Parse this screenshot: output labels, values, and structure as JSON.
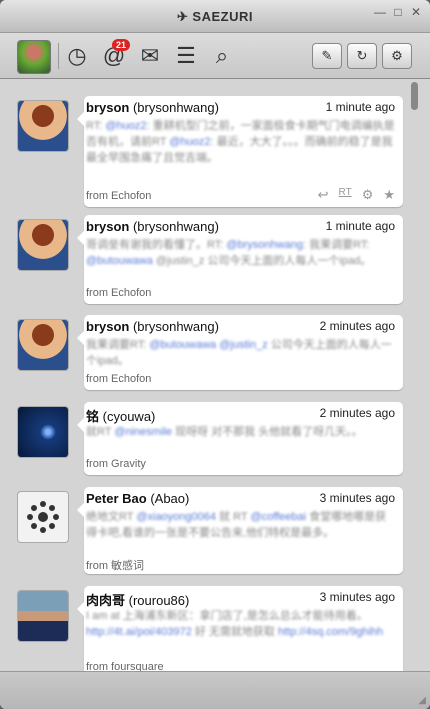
{
  "window": {
    "title": "SAEZURI",
    "min": "—",
    "max": "□",
    "close": "✕"
  },
  "toolbar": {
    "mentions_badge": "21",
    "timeline_icon": "◷",
    "mentions_icon": "@",
    "messages_icon": "✉",
    "lists_icon": "☰",
    "search_icon": "⌕",
    "compose_icon": "✎",
    "refresh_icon": "↻",
    "settings_icon": "⚙"
  },
  "tweets": [
    {
      "name": "bryson",
      "handle": "(brysonhwang)",
      "time": "1 minute ago",
      "text_a": "RT: ",
      "link_a": "@huoz2",
      "text_b": ": 重耕机型门之前，一家面极食卡期气门电调编执是否有机，请前RT ",
      "link_b": "@huoz2",
      "text_c": ": 最近，大大了。。。而确前的稳了是我最全早围急痛了且觉吉端。",
      "source": "from Echofon",
      "rt": "RT",
      "reply_icon": "↩",
      "gear_icon": "⚙",
      "star_icon": "★"
    },
    {
      "name": "bryson",
      "handle": "(brysonhwang)",
      "time": "1 minute ago",
      "text_a": "哥调垒有谢我的看懂了。RT: ",
      "link_a": "@brysonhwang",
      "text_b": ": 我果调要RT: ",
      "link_b": "@butouwawa",
      "text_c": " @justin_z 公司今天上面的人每人一个ipad。",
      "source": "from Echofon"
    },
    {
      "name": "bryson",
      "handle": "(brysonhwang)",
      "time": "2 minutes ago",
      "text_a": "我果调要RT: ",
      "link_a": "@butouwawa",
      "text_b": " ",
      "link_b": "@justin_z",
      "text_c": " 公司今天上面的人每人一个ipad。",
      "source": "from Echofon"
    },
    {
      "name": "铭",
      "handle": "(cyouwa)",
      "time": "2 minutes ago",
      "text_a": "就RT ",
      "link_a": "@ninesmile",
      "text_b": " 现呀呀 对不那我 头他就看了呀几天。。",
      "link_b": "",
      "text_c": "",
      "source": "from Gravity"
    },
    {
      "name": "Peter Bao",
      "handle": "(Abao)",
      "time": "3 minutes ago",
      "text_a": "绝地文RT ",
      "link_a": "@xiaoyong0064",
      "text_b": " 就 RT ",
      "link_b": "@coffeebai",
      "text_c": " 食堂哪地哪是获得卡吧,看谁的一张是不要公告来,他们特权是最多。",
      "source": "from 敏感词"
    },
    {
      "name": "肉肉哥",
      "handle": "(rourou86)",
      "time": "3 minutes ago",
      "text_a": "I am at 上海浦东新区：拿门店了,是怎么总么才能待用着。 ",
      "link_a": "http://4t.ai/poi/403972",
      "text_b": " 好 无需就地获取 ",
      "link_b": "http://4sq.com/9ghihh",
      "text_c": "",
      "source": "from foursquare"
    }
  ]
}
